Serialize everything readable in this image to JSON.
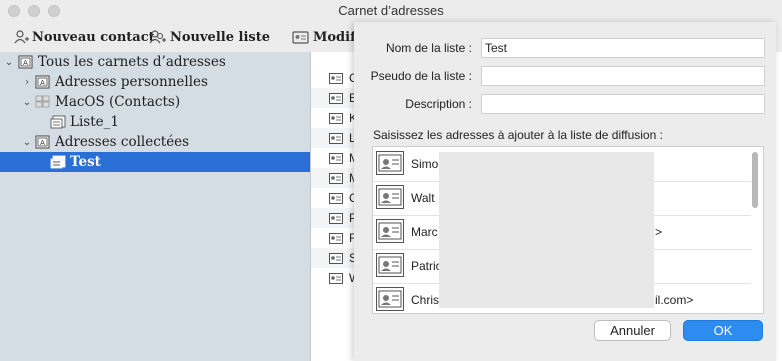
{
  "window": {
    "title": "Carnet d’adresses"
  },
  "toolbar": {
    "new_contact": "Nouveau contact",
    "new_list": "Nouvelle liste",
    "edit": "Modifi"
  },
  "sidebar": {
    "items": [
      {
        "label": "Tous les carnets d’adresses",
        "icon": "address-book-icon"
      },
      {
        "label": "Adresses personnelles",
        "icon": "address-book-icon"
      },
      {
        "label": "MacOS (Contacts)",
        "icon": "grid-icon"
      },
      {
        "label": "Liste_1",
        "icon": "list-icon"
      },
      {
        "label": "Adresses collectées",
        "icon": "address-book-icon"
      },
      {
        "label": "Test",
        "icon": "list-icon",
        "selected": true
      }
    ]
  },
  "contacts_list": {
    "initials": [
      "C",
      "E",
      "K",
      "L",
      "M",
      "M",
      "C",
      "P",
      "R",
      "S",
      "W"
    ]
  },
  "dialog": {
    "list_name_label": "Nom de la liste :",
    "list_name_value": "Test",
    "nickname_label": "Pseudo de la liste :",
    "nickname_value": "",
    "description_label": "Description :",
    "description_value": "",
    "instructions": "Saisissez les adresses à ajouter à la liste de diffusion :",
    "participants": [
      {
        "text": "Simo",
        "suffix": ""
      },
      {
        "text": "Walt",
        "suffix": ""
      },
      {
        "text": "Marc",
        "suffix": ">"
      },
      {
        "text": "Patric",
        "suffix": ""
      },
      {
        "text": "Chris",
        "suffix": "il.com>"
      }
    ],
    "cancel": "Annuler",
    "ok": "OK"
  },
  "colors": {
    "selection": "#2a6fd6",
    "ok_button": "#2d8cf0",
    "sidebar_bg": "#d5dde4"
  }
}
